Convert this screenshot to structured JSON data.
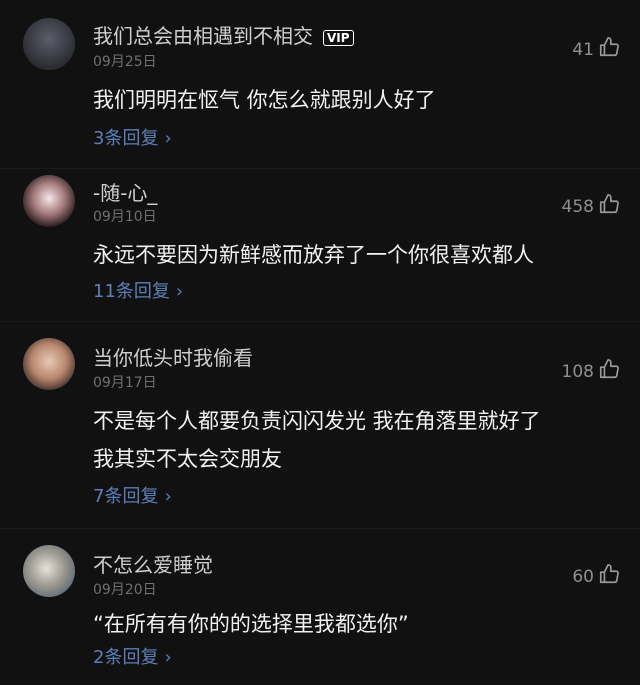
{
  "comments": [
    {
      "user": "我们总会由相遇到不相交",
      "badge": "VIP",
      "date": "09月25日",
      "likes": "41",
      "lines": [
        "我们明明在怄气 你怎么就跟别人好了"
      ],
      "replies": "3条回复",
      "avatar_colors": [
        "#2c2d33",
        "#5a5e6a"
      ]
    },
    {
      "user": "-随-心_",
      "date": "09月10日",
      "likes": "458",
      "lines": [
        "永远不要因为新鲜感而放弃了一个你很喜欢都人"
      ],
      "replies": "11条回复",
      "avatar_colors": [
        "#f3e7e8",
        "#2a1a1c"
      ]
    },
    {
      "user": "当你低头时我偷看",
      "date": "09月17日",
      "likes": "108",
      "lines": [
        "不是每个人都要负责闪闪发光 我在角落里就好了",
        "我其实不太会交朋友"
      ],
      "replies": "7条回复",
      "avatar_colors": [
        "#d8b7a2",
        "#3a2a26"
      ]
    },
    {
      "user": "不怎么爱睡觉",
      "date": "09月20日",
      "likes": "60",
      "lines": [
        "“在所有有你的的选择里我都选你”"
      ],
      "replies": "2条回复",
      "avatar_colors": [
        "#c9c4bd",
        "#5c6773"
      ]
    }
  ]
}
